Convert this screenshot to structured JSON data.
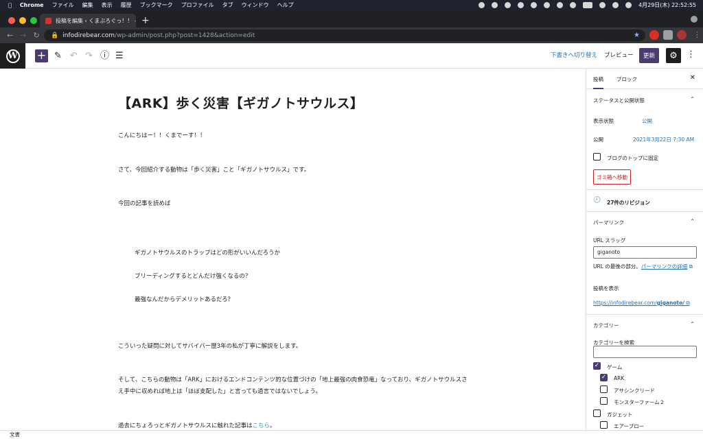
{
  "menubar": {
    "app": "Chrome",
    "items": [
      "ファイル",
      "編集",
      "表示",
      "履歴",
      "ブックマーク",
      "プロファイル",
      "タブ",
      "ウィンドウ",
      "ヘルプ"
    ],
    "clock": "4月29日(木) 22:52:55"
  },
  "browser": {
    "tab_title": "投稿を編集 ‹ くまぶろぐっ！！ —",
    "url_host": "infodirebear.com",
    "url_path": "/wp-admin/post.php?post=1428&action=edit"
  },
  "toolbar": {
    "switch_to_draft": "下書きへ切り替え",
    "preview": "プレビュー",
    "update": "更新"
  },
  "post": {
    "title": "【ARK】歩く災害【ギガノトサウルス】",
    "p1": "こんにちはー！！くまでーす！！",
    "p2": "さて、今回紹介する動物は「歩く災害」こと「ギガノトサウルス」です。",
    "p3": "今回の記事を読めば",
    "list": [
      "ギガノトサウルスのトラップはどの形がいいんだろうか",
      "ブリーディングするとどんだけ強くなるの？",
      "最強なんだからデメリットあるだろ？"
    ],
    "p4": "こういった疑問に対してサバイバー歴3年の私が丁寧に解説をします。",
    "p5": "そして、こちらの動物は「ARK」におけるエンドコンテンツ的な位置づけの「地上最強の肉食恐竜」なっており、ギガノトサウルスさえ手中に収めれば地上は「ほぼ支配した」と言っても過言ではないでしょう。",
    "p6_prefix": "過去にちょろっとギガノトサウルスに触れた記事は",
    "p6_link": "こちら",
    "p6_suffix": "。"
  },
  "statusbar": {
    "label": "文書"
  },
  "sidebar": {
    "tab_post": "投稿",
    "tab_block": "ブロック",
    "status_heading": "ステータスと公開状態",
    "visibility_label": "表示状態",
    "visibility_value": "公開",
    "publish_label": "公開",
    "publish_value": "2021年3月22日 7:30 AM",
    "sticky_label": "ブログのトップに固定",
    "trash_button": "ゴミ箱へ移動",
    "revisions": "27件のリビジョン",
    "permalink_heading": "パーマリンク",
    "url_slug_label": "URL スラッグ",
    "url_slug_value": "giganoto",
    "url_help_prefix": "URL の最後の部分。",
    "url_help_link": "パーマリンクの詳細",
    "view_post_label": "投稿を表示",
    "view_post_url_prefix": "https://infodirebear.com/",
    "view_post_url_slug": "giganoto/",
    "categories_heading": "カテゴリー",
    "category_search_label": "カテゴリーを検索",
    "categories": [
      {
        "name": "ゲーム",
        "checked": true
      },
      {
        "name": "ARK",
        "checked": true
      },
      {
        "name": "アサシンクリード",
        "checked": false
      },
      {
        "name": "モンスターファーム２",
        "checked": false
      },
      {
        "name": "ガジェット",
        "checked": false
      },
      {
        "name": "エアープロー",
        "checked": false
      }
    ]
  }
}
